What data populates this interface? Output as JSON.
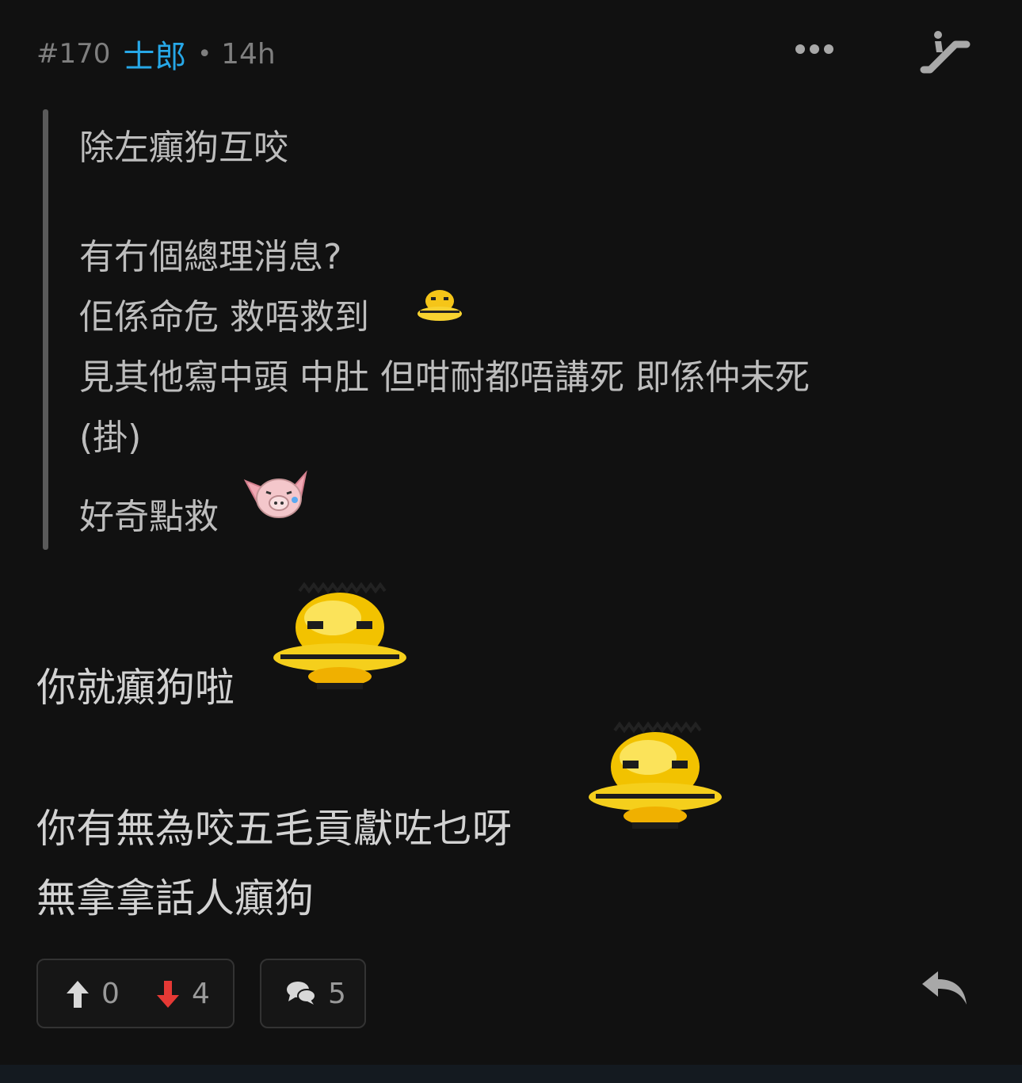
{
  "post": {
    "number": "#170",
    "author": "士郎",
    "separator": "•",
    "time": "14h"
  },
  "quote": {
    "lines": [
      "除左癲狗互咬",
      "有冇個總理消息?",
      "佢係命危 救唔救到",
      "見其他寫中頭 中肚 但咁耐都唔講死 即係仲未死",
      "(掛)",
      "好奇點救"
    ]
  },
  "body": {
    "lines": [
      "你就癲狗啦",
      "你有無為咬五毛貢獻咗乜呀",
      "無拿拿話人癲狗"
    ]
  },
  "actions": {
    "upvotes": "0",
    "downvotes": "4",
    "comments": "5"
  },
  "icons": {
    "more": "more-dots-icon",
    "escalator": "escalator-icon",
    "upvote": "arrow-up-icon",
    "downvote": "arrow-down-icon",
    "comment": "chat-bubbles-icon",
    "reply": "reply-icon"
  },
  "colors": {
    "background": "#111111",
    "author": "#27a8e8",
    "downvote": "#e53935",
    "upvote": "#d8d8d8"
  }
}
